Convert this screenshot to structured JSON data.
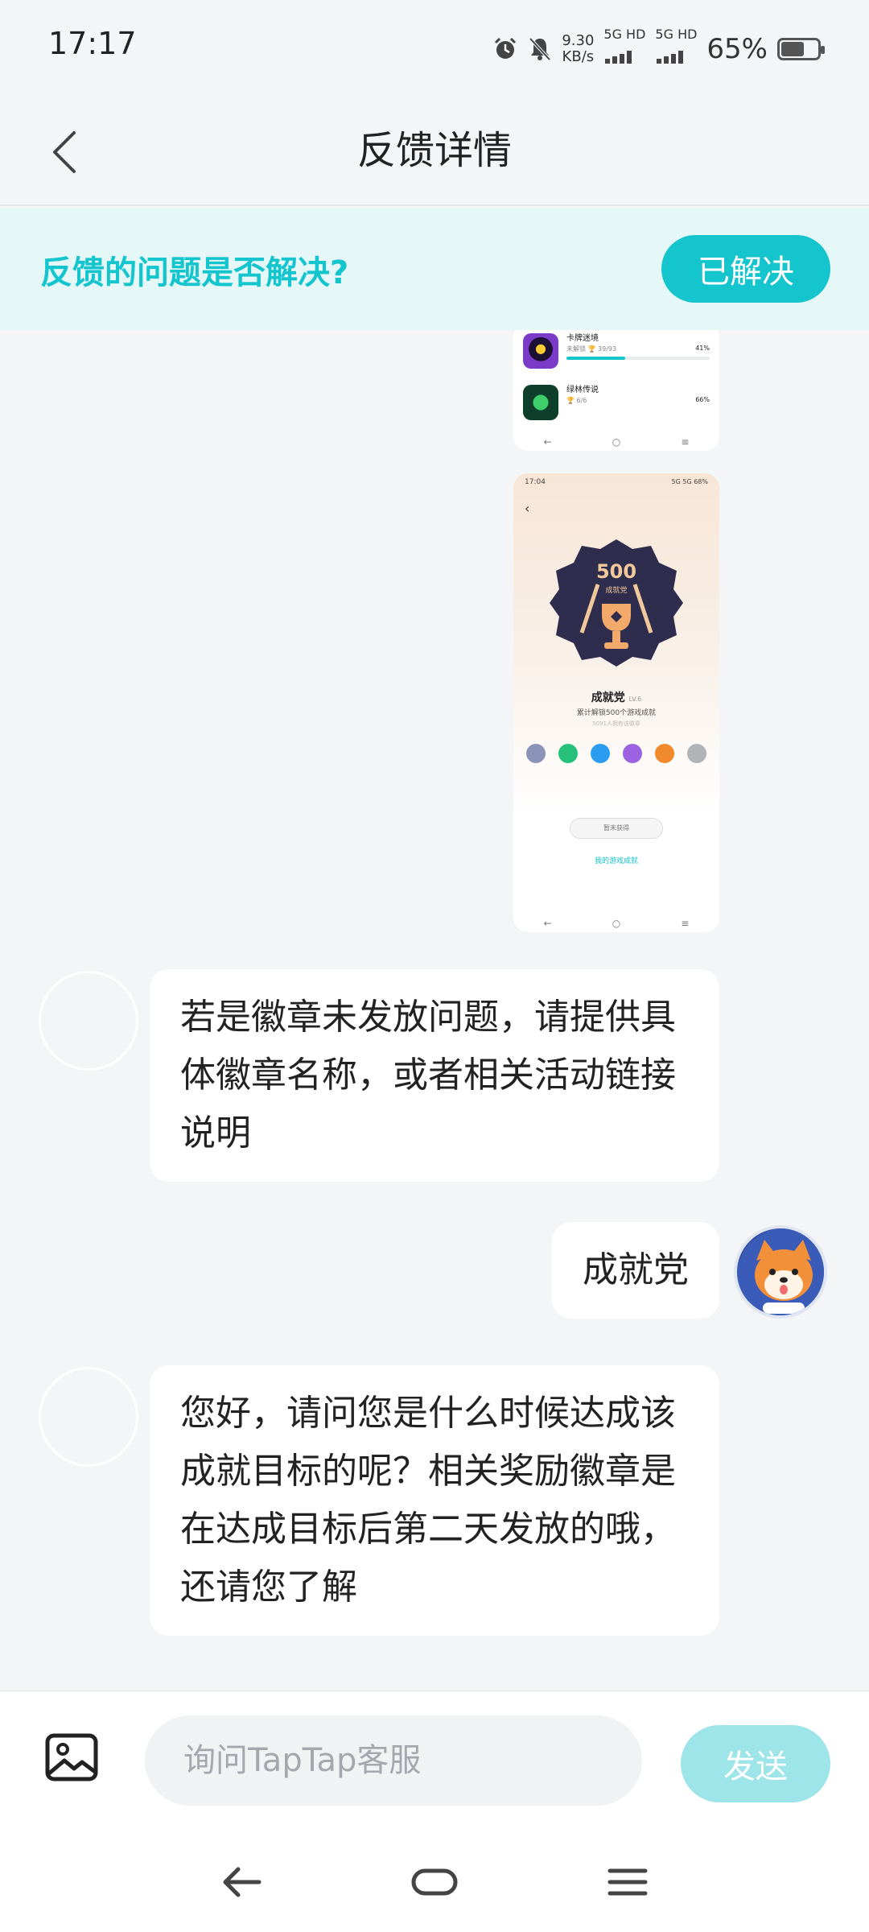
{
  "status_bar": {
    "time": "17:17",
    "net_speed_value": "9.30",
    "net_speed_unit": "KB/s",
    "sim1": "5G HD",
    "sim2": "5G HD",
    "battery": "65%"
  },
  "header": {
    "title": "反馈详情"
  },
  "resolve_banner": {
    "question": "反馈的问题是否解决?",
    "button_label": "已解决"
  },
  "screenshot_1": {
    "rows": [
      {
        "name": "卡牌迷境",
        "sub": "未解锁  🏆 39/93",
        "percent": "41%",
        "progress": 0.41
      },
      {
        "name": "绿林传说",
        "sub": "🏆 6/6",
        "percent": "66%",
        "progress": 0.66
      }
    ]
  },
  "screenshot_2": {
    "time": "17:04",
    "status": "5G 5G 68%",
    "badge_number": "500",
    "badge_caption": "成就党",
    "title": "成就党",
    "level": "LV.6",
    "description": "累计解锁500个游戏成就",
    "sub_description": "5091人拥有该徽章",
    "button": "暂未获得",
    "link": "我的游戏成就",
    "gem_colors": [
      "#8b93b8",
      "#27c07a",
      "#2a9df0",
      "#9b63e0",
      "#f08a2c",
      "#b0b4b8"
    ]
  },
  "messages": [
    {
      "from": "agent",
      "text": "若是徽章未发放问题，请提供具体徽章名称，或者相关活动链接说明"
    },
    {
      "from": "user",
      "text": "成就党"
    },
    {
      "from": "agent",
      "text": "您好，请问您是什么时候达成该成就目标的呢？相关奖励徽章是在达成目标后第二天发放的哦，还请您了解"
    }
  ],
  "input_bar": {
    "placeholder": "询问TapTap客服",
    "send_label": "发送",
    "image_icon": "image-icon"
  },
  "colors": {
    "accent": "#15c5ce",
    "banner_bg": "#e6f7f8",
    "send_disabled": "#9ee5e9",
    "page_bg": "#f4f5f7"
  }
}
